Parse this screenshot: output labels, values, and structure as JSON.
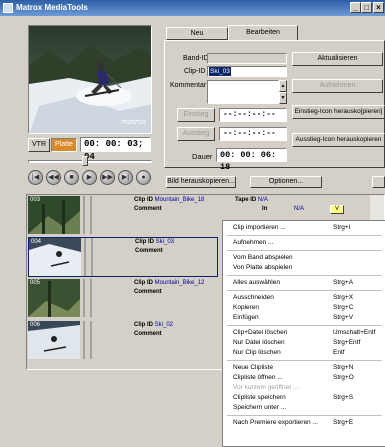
{
  "window": {
    "title": "Matrox MediaTools",
    "controls": [
      "_",
      "□",
      "×"
    ]
  },
  "tabs": [
    "Neu",
    "Bearbeiten"
  ],
  "form": {
    "band_id_label": "Band-ID",
    "clip_id_label": "Clip-ID",
    "clip_id_value": "Ski_03",
    "comment_label": "Kommentar",
    "aktualisieren": "Aktualisieren",
    "aufnehmen": "Aufnehmen",
    "einstieg": "Einstieg",
    "ausstieg": "Ausstieg",
    "einstieg_tc": "--:--:--:--",
    "ausstieg_tc": "--:--:--:--",
    "einstieg_icon_btn": "Einstieg-Icon herausko[pieren]",
    "ausstieg_icon_btn": "Ausstieg-Icon herauskopieren",
    "dauer_label": "Dauer",
    "dauer_value": "00: 00: 06: 18",
    "bild_btn": "Bild herauskopieren...",
    "optionen_btn": "Optionen..."
  },
  "transport": {
    "vtr": "VTR",
    "platte": "Platte",
    "timecode": "00: 00: 03; 04",
    "buttons": [
      "|◀",
      "◀◀",
      "■",
      "▶",
      "▶▶",
      "▶|",
      "●"
    ]
  },
  "clips": [
    {
      "num": "003",
      "clip_id_label": "Clip ID",
      "clip_id": "Mountain_Bike_18",
      "comment_label": "Comment",
      "tape_label": "Tape ID",
      "tape_id": "N/A",
      "in_label": "In",
      "in_value": "N/A",
      "badge": "V"
    },
    {
      "num": "004",
      "clip_id_label": "Clip ID",
      "clip_id": "Ski_03",
      "comment_label": "Comment"
    },
    {
      "num": "005",
      "clip_id_label": "Clip ID",
      "clip_id": "Mountain_Bike_12",
      "comment_label": "Comment"
    },
    {
      "num": "006",
      "clip_id_label": "Clip ID",
      "clip_id": "Ski_02",
      "comment_label": "Comment"
    }
  ],
  "context_menu": [
    {
      "label": "Clip importieren ...",
      "shortcut": "Strg+I"
    },
    {
      "sep": true
    },
    {
      "label": "Aufnehmen ...",
      "shortcut": ""
    },
    {
      "sep": true
    },
    {
      "label": "Vom Band abspielen",
      "shortcut": ""
    },
    {
      "label": "Von Platte abspielen",
      "shortcut": ""
    },
    {
      "sep": true
    },
    {
      "label": "Alles auswählen",
      "shortcut": "Strg+A"
    },
    {
      "sep": true
    },
    {
      "label": "Ausschneiden",
      "shortcut": "Strg+X"
    },
    {
      "label": "Kopieren",
      "shortcut": "Strg+C"
    },
    {
      "label": "Einfügen",
      "shortcut": "Strg+V"
    },
    {
      "sep": true
    },
    {
      "label": "Clip+Datei löschen",
      "shortcut": "Umschalt+Entf"
    },
    {
      "label": "Nur Datei löschen",
      "shortcut": "Strg+Entf"
    },
    {
      "label": "Nur Clip löschen",
      "shortcut": "Entf"
    },
    {
      "sep": true
    },
    {
      "label": "Neue Clipliste",
      "shortcut": "Strg+N"
    },
    {
      "label": "Clipliste öffnen ...",
      "shortcut": "Strg+O"
    },
    {
      "label": "Vor kurzem geöffnet ...",
      "shortcut": "",
      "disabled": true
    },
    {
      "label": "Clipliste speichern",
      "shortcut": "Strg+S"
    },
    {
      "label": "Speichern unter ...",
      "shortcut": ""
    },
    {
      "sep": true
    },
    {
      "label": "Nach Premiere exportieren ...",
      "shortcut": "Strg+E"
    }
  ],
  "colors": {
    "title_start": "#2b5ea8",
    "title_end": "#6f9bd6",
    "platte_active": "#d98a2a",
    "clip_value": "#0000a0"
  }
}
